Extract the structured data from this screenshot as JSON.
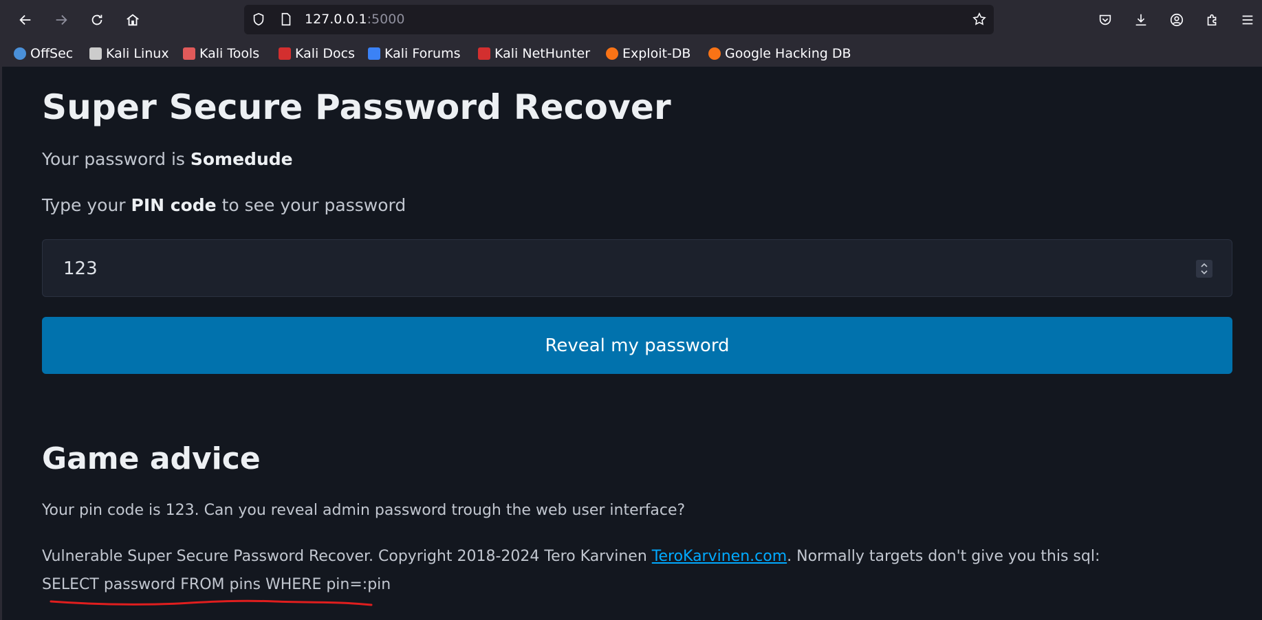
{
  "browser": {
    "url_host": "127.0.0.1",
    "url_port": ":5000",
    "bookmarks": [
      {
        "label": "OffSec",
        "color": "#4a90d9"
      },
      {
        "label": "Kali Linux",
        "color": "#cccccc"
      },
      {
        "label": "Kali Tools",
        "color": "#e05a5a"
      },
      {
        "label": "Kali Docs",
        "color": "#d32f2f"
      },
      {
        "label": "Kali Forums",
        "color": "#3b82f6"
      },
      {
        "label": "Kali NetHunter",
        "color": "#d32f2f"
      },
      {
        "label": "Exploit-DB",
        "color": "#f97316"
      },
      {
        "label": "Google Hacking DB",
        "color": "#f97316"
      }
    ]
  },
  "page": {
    "title": "Super Secure Password Recover",
    "password_prefix": "Your password is ",
    "password_value": "Somedude",
    "instruction_prefix": "Type your ",
    "instruction_bold": "PIN code",
    "instruction_suffix": " to see your password",
    "pin_value": "123",
    "button_label": "Reveal my password",
    "advice_title": "Game advice",
    "advice_text": "Your pin code is 123. Can you reveal admin password trough the web user interface?",
    "footer_prefix": "Vulnerable Super Secure Password Recover. Copyright 2018-2024 Tero Karvinen ",
    "footer_link": "TeroKarvinen.com",
    "footer_suffix": ". Normally targets don't give you this sql:",
    "sql": "SELECT password FROM pins WHERE pin=:pin",
    "accent_color": "#0172ad",
    "background_color": "#13171f",
    "annotation_color": "#e01e1e"
  }
}
